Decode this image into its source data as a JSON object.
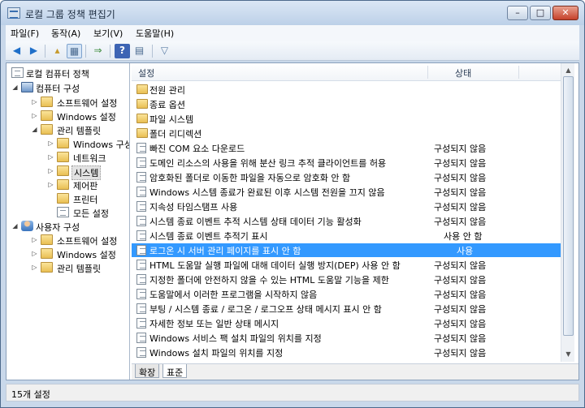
{
  "window": {
    "title": "로컬 그룹 정책 편집기",
    "minimize": "–",
    "maximize": "□",
    "close": "✕"
  },
  "menu": [
    "파일(F)",
    "동작(A)",
    "보기(V)",
    "도움말(H)"
  ],
  "toolbar_icons": [
    "back-arrow-icon",
    "forward-arrow-icon",
    "up-folder-icon",
    "show-hide-tree-icon",
    "export-list-icon",
    "help-icon",
    "properties-icon",
    "filter-icon"
  ],
  "tree": [
    {
      "label": "로컬 컴퓨터 정책",
      "icon": "policy-icon",
      "expander": ""
    },
    {
      "label": "컴퓨터 구성",
      "icon": "computer-icon",
      "expander": "◢"
    },
    {
      "label": "소프트웨어 설정",
      "icon": "folder-icon",
      "expander": "▷"
    },
    {
      "label": "Windows 설정",
      "icon": "folder-icon",
      "expander": "▷"
    },
    {
      "label": "관리 템플릿",
      "icon": "folder-icon",
      "expander": "◢"
    },
    {
      "label": "Windows 구성",
      "icon": "folder-icon",
      "expander": "▷"
    },
    {
      "label": "네트워크",
      "icon": "folder-icon",
      "expander": "▷"
    },
    {
      "label": "시스템",
      "icon": "folder-icon",
      "expander": "▷"
    },
    {
      "label": "제어판",
      "icon": "folder-icon",
      "expander": "▷"
    },
    {
      "label": "프린터",
      "icon": "folder-icon",
      "expander": ""
    },
    {
      "label": "모든 설정",
      "icon": "settings-icon",
      "expander": ""
    },
    {
      "label": "사용자 구성",
      "icon": "user-icon",
      "expander": "◢"
    },
    {
      "label": "소프트웨어 설정",
      "icon": "folder-icon",
      "expander": "▷"
    },
    {
      "label": "Windows 설정",
      "icon": "folder-icon",
      "expander": "▷"
    },
    {
      "label": "관리 템플릿",
      "icon": "folder-icon",
      "expander": "▷"
    }
  ],
  "list": {
    "col_name": "설정",
    "col_state": "상태",
    "rows": [
      {
        "name": "전원 관리",
        "state": "",
        "icon": "folder-icon"
      },
      {
        "name": "종료 옵션",
        "state": "",
        "icon": "folder-icon"
      },
      {
        "name": "파일 시스템",
        "state": "",
        "icon": "folder-icon"
      },
      {
        "name": "폴더 리디렉션",
        "state": "",
        "icon": "folder-icon"
      },
      {
        "name": "빠진 COM 요소 다운로드",
        "state": "구성되지 않음",
        "icon": "setting-icon"
      },
      {
        "name": "도메인 리소스의 사용을 위해 분산 링크 추적 클라이언트를 허용",
        "state": "구성되지 않음",
        "icon": "setting-icon"
      },
      {
        "name": "암호화된 폴더로 이동한 파일을 자동으로 암호화 안 함",
        "state": "구성되지 않음",
        "icon": "setting-icon"
      },
      {
        "name": "Windows 시스템 종료가 완료된 이후 시스템 전원을 끄지 않음",
        "state": "구성되지 않음",
        "icon": "setting-icon"
      },
      {
        "name": "지속성 타임스탬프 사용",
        "state": "구성되지 않음",
        "icon": "setting-icon"
      },
      {
        "name": "시스템 종료 이벤트 추적 시스템 상태 데이터 기능 활성화",
        "state": "구성되지 않음",
        "icon": "setting-icon"
      },
      {
        "name": "시스템 종료 이벤트 추적기 표시",
        "state": "사용 안 함",
        "icon": "setting-icon"
      },
      {
        "name": "로그온 시 서버 관리 페이지를 표시 안 함",
        "state": "사용",
        "icon": "setting-icon"
      },
      {
        "name": "HTML 도움말 실행 파일에 대해 데이터 실행 방지(DEP) 사용 안 함",
        "state": "구성되지 않음",
        "icon": "setting-icon"
      },
      {
        "name": "지정한 폴더에 안전하지 않을 수 있는 HTML 도움말 기능을 제한",
        "state": "구성되지 않음",
        "icon": "setting-icon"
      },
      {
        "name": "도움말에서 이러한 프로그램을 시작하지 않음",
        "state": "구성되지 않음",
        "icon": "setting-icon"
      },
      {
        "name": "부팅 / 시스템 종료 / 로그온 / 로그오프 상태 메시지 표시 안 함",
        "state": "구성되지 않음",
        "icon": "setting-icon"
      },
      {
        "name": "자세한 정보 또는 일반 상태 메시지",
        "state": "구성되지 않음",
        "icon": "setting-icon"
      },
      {
        "name": "Windows 서비스 팩 설치 파일의 위치를 지정",
        "state": "구성되지 않음",
        "icon": "setting-icon"
      },
      {
        "name": "Windows 설치 파일의 위치를 지정",
        "state": "구성되지 않음",
        "icon": "setting-icon"
      }
    ]
  },
  "tabs": [
    "확장",
    "표준"
  ],
  "status": "15개 설정"
}
